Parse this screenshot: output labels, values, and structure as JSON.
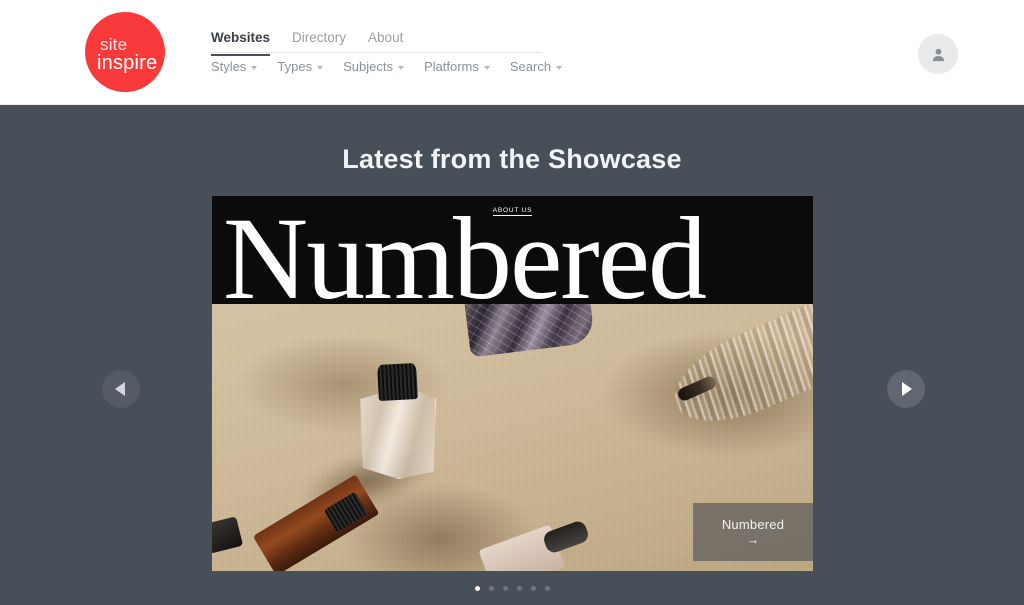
{
  "brand": {
    "logo_line1": "site",
    "logo_line2": "inspire",
    "logo_color": "#f93a3a"
  },
  "header": {
    "primary_nav": [
      {
        "label": "Websites",
        "active": true
      },
      {
        "label": "Directory",
        "active": false
      },
      {
        "label": "About",
        "active": false
      }
    ],
    "secondary_nav": [
      {
        "label": "Styles"
      },
      {
        "label": "Types"
      },
      {
        "label": "Subjects"
      },
      {
        "label": "Platforms"
      },
      {
        "label": "Search"
      }
    ],
    "account_icon": "user-avatar-icon"
  },
  "showcase": {
    "title": "Latest from the Showcase",
    "background_color": "#474f59",
    "slide": {
      "site_nav_label": "ABOUT US",
      "hero_word": "Numbered",
      "caption": "Numbered  →",
      "caption_name": "Numbered",
      "caption_arrow": "→"
    },
    "controls": {
      "prev_label": "Previous slide",
      "next_label": "Next slide",
      "prev_icon": "chevron-left-icon",
      "next_icon": "chevron-right-icon"
    },
    "pagination": {
      "total": 6,
      "active_index": 0
    }
  }
}
